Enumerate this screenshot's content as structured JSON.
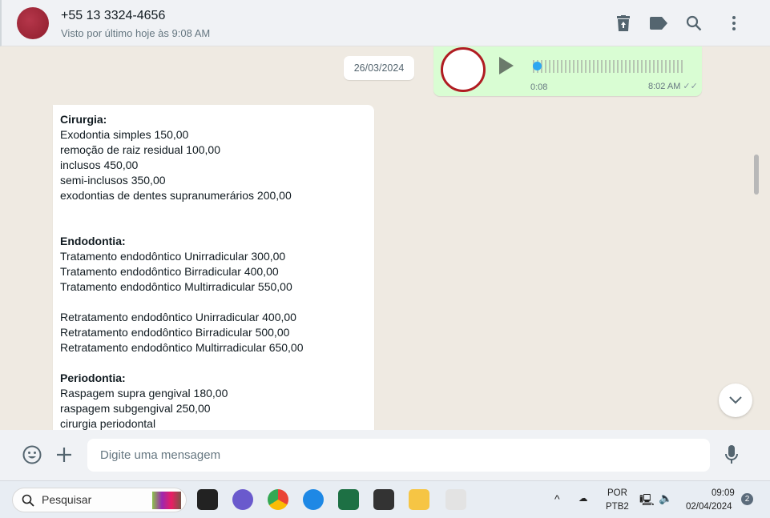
{
  "header": {
    "contact": "+55 13 3324-4656",
    "status": "Visto por último hoje às 9:08 AM",
    "icons": [
      "delete-icon",
      "label-icon",
      "search-icon",
      "more-vert-icon"
    ]
  },
  "chat": {
    "date_badge": "26/03/2024",
    "audio": {
      "duration": "0:08",
      "time": "8:02 AM",
      "progress": 0
    },
    "message_lines": [
      {
        "text": "Cirurgia:",
        "bold": true
      },
      {
        "text": "Exodontia simples 150,00"
      },
      {
        "text": "remoção de raiz residual 100,00"
      },
      {
        "text": "inclusos 450,00"
      },
      {
        "text": "semi-inclusos 350,00"
      },
      {
        "text": "exodontias de dentes supranumerários 200,00"
      },
      {
        "text": ""
      },
      {
        "text": ""
      },
      {
        "text": "Endodontia:",
        "bold": true
      },
      {
        "text": "Tratamento endodôntico Unirradicular 300,00"
      },
      {
        "text": "Tratamento endodôntico Birradicular 400,00"
      },
      {
        "text": "Tratamento endodôntico Multirradicular 550,00"
      },
      {
        "text": ""
      },
      {
        "text": "Retratamento endodôntico Unirradicular 400,00"
      },
      {
        "text": "Retratamento endodôntico Birradicular 500,00"
      },
      {
        "text": "Retratamento endodôntico Multirradicular 650,00"
      },
      {
        "text": ""
      },
      {
        "text": "Periodontia:",
        "bold": true
      },
      {
        "text": "Raspagem supra gengival 180,00"
      },
      {
        "text": "raspagem subgengival 250,00"
      },
      {
        "text": "cirurgia periodontal"
      }
    ]
  },
  "composer": {
    "placeholder": "Digite uma mensagem"
  },
  "taskbar": {
    "search": "Pesquisar",
    "lang1": "POR",
    "lang2": "PTB2",
    "time": "09:09",
    "date": "02/04/2024",
    "notifications": "2"
  },
  "colors": {
    "outgoing": "#d9fdd3",
    "header": "#f0f2f5",
    "chat_bg": "#efeae2"
  }
}
